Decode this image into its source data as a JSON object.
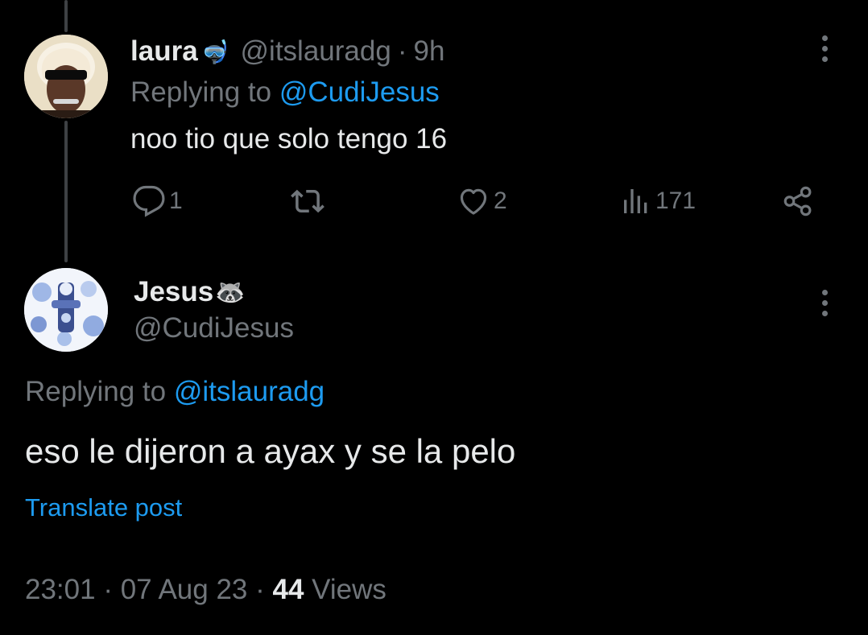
{
  "post1": {
    "display_name": "laura",
    "name_emoji": "🤿",
    "handle": "@itslauradg",
    "separator": "·",
    "time_ago": "9h",
    "replying_prefix": "Replying to",
    "replying_to": "@CudiJesus",
    "text": "noo tio que solo tengo 16",
    "actions": {
      "replies": "1",
      "reposts": "",
      "likes": "2",
      "views": "171"
    },
    "icons": [
      "reply-icon",
      "repost-icon",
      "like-icon",
      "views-icon",
      "share-icon",
      "more-icon"
    ]
  },
  "post2": {
    "display_name": "Jesus",
    "name_emoji": "🦝",
    "handle": "@CudiJesus",
    "replying_prefix": "Replying to",
    "replying_to": "@itslauradg",
    "text": "eso le dijeron a ayax y se la pelo",
    "translate_label": "Translate post",
    "time": "23:01",
    "date": "07 Aug 23",
    "separator": "·",
    "views_count": "44",
    "views_label": "Views"
  },
  "colors": {
    "background": "#000000",
    "text_primary": "#e7e9ea",
    "text_muted": "#71767b",
    "accent": "#1d9bf0",
    "thread_line": "#3e4144"
  }
}
